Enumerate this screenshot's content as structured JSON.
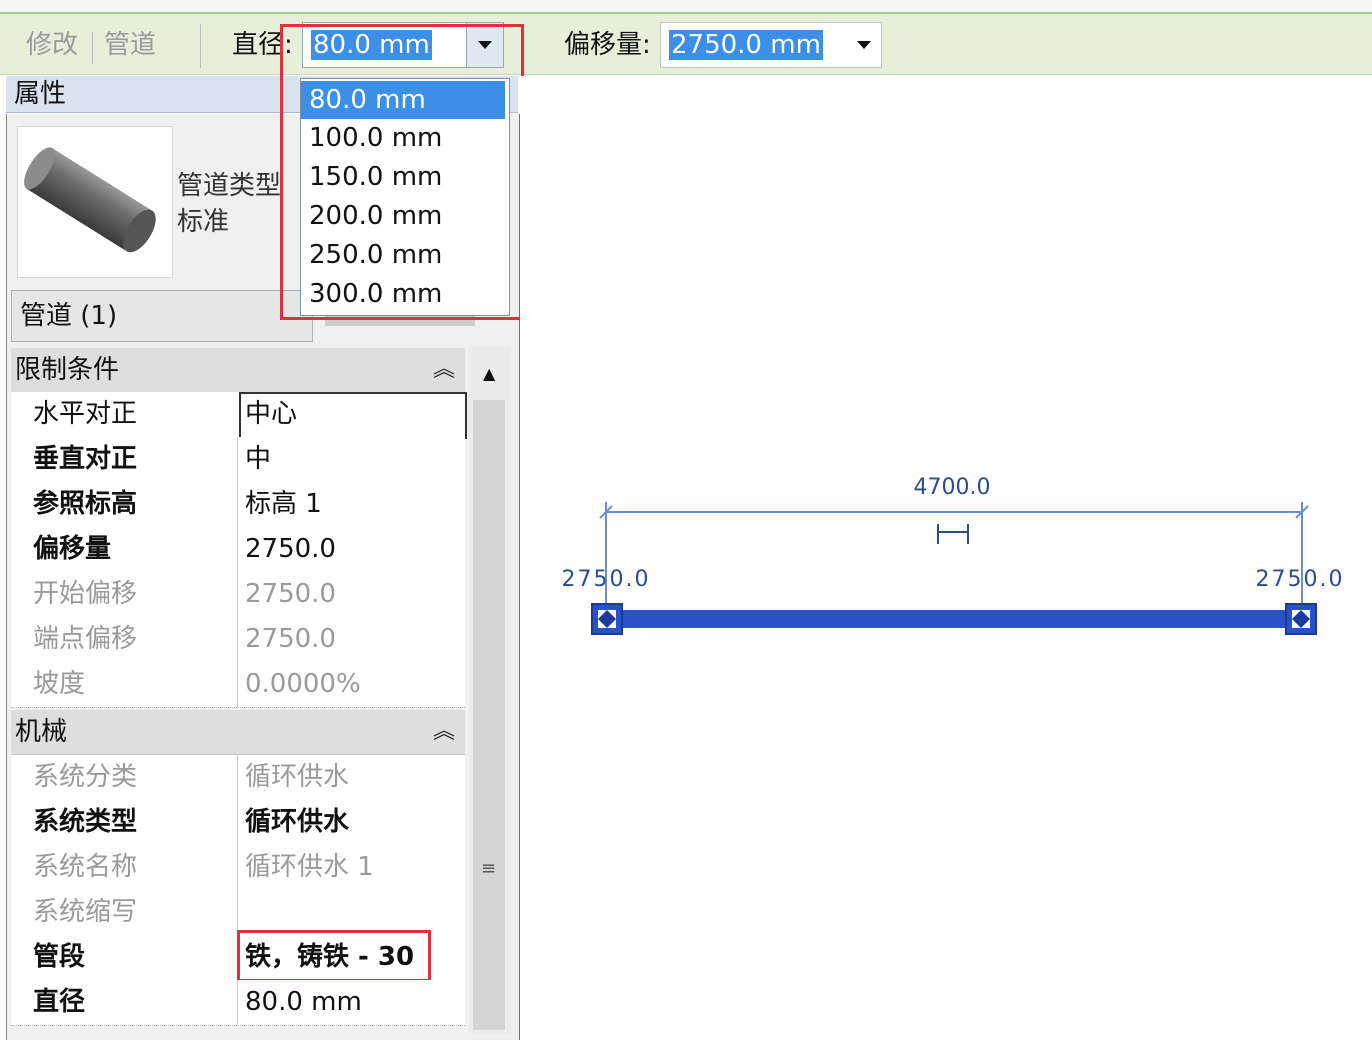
{
  "toolbar": {
    "modify_label": "修改",
    "context_label": "管道",
    "diameter_label": "直径:",
    "diameter_value": "80.0 mm",
    "offset_label": "偏移量:",
    "offset_value": "2750.0 mm"
  },
  "diameter_dropdown": {
    "options": [
      "80.0 mm",
      "100.0 mm",
      "150.0 mm",
      "200.0 mm",
      "250.0 mm",
      "300.0 mm"
    ],
    "selected": "80.0 mm"
  },
  "properties": {
    "title": "属性",
    "type_category": "管道类型",
    "type_name": "标准",
    "selection": "管道 (1)",
    "groups": [
      {
        "name": "限制条件",
        "rows": [
          {
            "key": "水平对正",
            "value": "中心",
            "state": "editing"
          },
          {
            "key": "垂直对正",
            "value": "中",
            "state": "normal"
          },
          {
            "key": "参照标高",
            "value": "标高 1",
            "state": "normal"
          },
          {
            "key": "偏移量",
            "value": "2750.0",
            "state": "normal"
          },
          {
            "key": "开始偏移",
            "value": "2750.0",
            "state": "readonly"
          },
          {
            "key": "端点偏移",
            "value": "2750.0",
            "state": "readonly"
          },
          {
            "key": "坡度",
            "value": "0.0000%",
            "state": "readonly"
          }
        ]
      },
      {
        "name": "机械",
        "rows": [
          {
            "key": "系统分类",
            "value": "循环供水",
            "state": "readonly"
          },
          {
            "key": "系统类型",
            "value": "循环供水",
            "state": "normal"
          },
          {
            "key": "系统名称",
            "value": "循环供水 1",
            "state": "readonly"
          },
          {
            "key": "系统缩写",
            "value": "",
            "state": "readonly"
          },
          {
            "key": "管段",
            "value": "铁，铸铁 - 30",
            "state": "highlighted"
          },
          {
            "key": "直径",
            "value": "80.0 mm",
            "state": "normal"
          }
        ]
      }
    ]
  },
  "canvas": {
    "length_dimension": "4700.0",
    "start_offset": "2750.0",
    "end_offset": "2750.0"
  },
  "colors": {
    "selection_blue": "#3d8ee6",
    "highlight_red": "#e0323c",
    "pipe_blue": "#2a52c8",
    "ribbon_green": "#e8efd9"
  },
  "icons": [
    "dropdown-arrow-icon",
    "pipe-3d-preview-icon",
    "collapse-icon",
    "scroll-up-icon"
  ]
}
